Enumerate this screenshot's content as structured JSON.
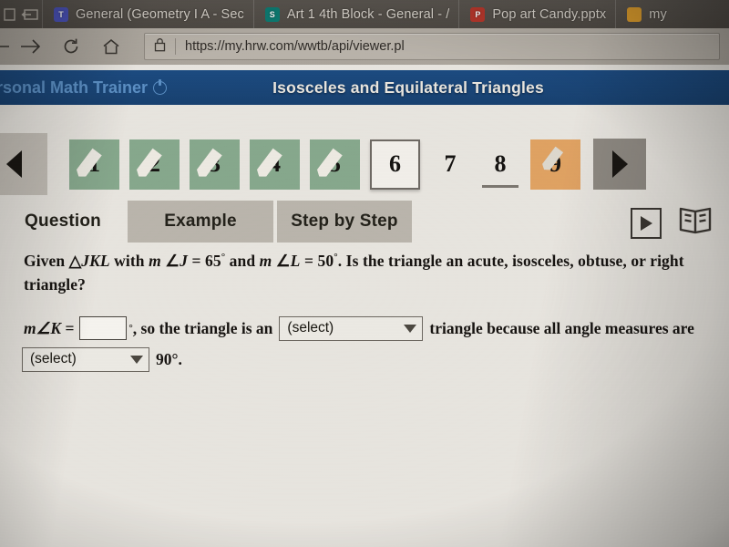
{
  "browser": {
    "tabs": [
      {
        "label": "General (Geometry I A - Sec",
        "favicon": "teams-icon",
        "favicon_letter": "T"
      },
      {
        "label": "Art 1 4th Block - General - /",
        "favicon": "sway-icon",
        "favicon_letter": "S"
      },
      {
        "label": "Pop art Candy.pptx",
        "favicon": "powerpoint-icon",
        "favicon_letter": "P"
      },
      {
        "label": "my",
        "favicon": "generic-dot-icon",
        "favicon_letter": ""
      }
    ],
    "nav": {
      "back_icon": "back-arrow-icon",
      "forward_icon": "forward-arrow-icon",
      "reload_icon": "reload-icon",
      "home_icon": "home-icon",
      "lock_icon": "lock-icon",
      "url": "https://my.hrw.com/wwtb/api/viewer.pl"
    }
  },
  "app": {
    "brand": "ersonal Math Trainer",
    "brand_icon": "refresh-circle-icon",
    "title": "Isosceles and Equilateral Triangles",
    "header_color": "#1b4a80",
    "done_color": "#86a88c",
    "flag_color": "#e0a262"
  },
  "steps": {
    "prev_icon": "previous-arrow-icon",
    "next_icon": "next-arrow-icon",
    "items": [
      {
        "number": "1",
        "state": "done"
      },
      {
        "number": "2",
        "state": "done"
      },
      {
        "number": "3",
        "state": "done"
      },
      {
        "number": "4",
        "state": "done"
      },
      {
        "number": "5",
        "state": "done"
      },
      {
        "number": "6",
        "state": "current"
      },
      {
        "number": "7",
        "state": "plain"
      },
      {
        "number": "8",
        "state": "underlined"
      },
      {
        "number": "9",
        "state": "flag"
      }
    ]
  },
  "subtabs": [
    {
      "label": "Question",
      "active": true
    },
    {
      "label": "Example",
      "active": false
    },
    {
      "label": "Step by Step",
      "active": false
    }
  ],
  "tools": {
    "video_icon": "video-play-icon",
    "book_icon": "open-book-icon"
  },
  "question": {
    "line1_a": "Given ",
    "triangle_symbol": "△",
    "triangle_name": "JKL",
    "line1_b": " with ",
    "m1": "m",
    "angle_symbol": "∠",
    "angle1": "J",
    "eq": " = ",
    "value1": "65",
    "deg": "°",
    "line1_c": " and ",
    "m2": "m",
    "angle2": "L",
    "value2": "50",
    "line1_d": ". Is the triangle an acute, isosceles, obtuse, or right triangle?"
  },
  "answer": {
    "lead_m": "m",
    "lead_angle": "∠",
    "lead_k": "K",
    "lead_eq": " = ",
    "input_value": "",
    "input_placeholder": "",
    "deg_after_input": "°",
    "mid_text": ", so the triangle is an",
    "select1_value": "(select)",
    "after_select1": "triangle because all angle measures are",
    "select2_value": "(select)",
    "tail_text": "90°."
  }
}
